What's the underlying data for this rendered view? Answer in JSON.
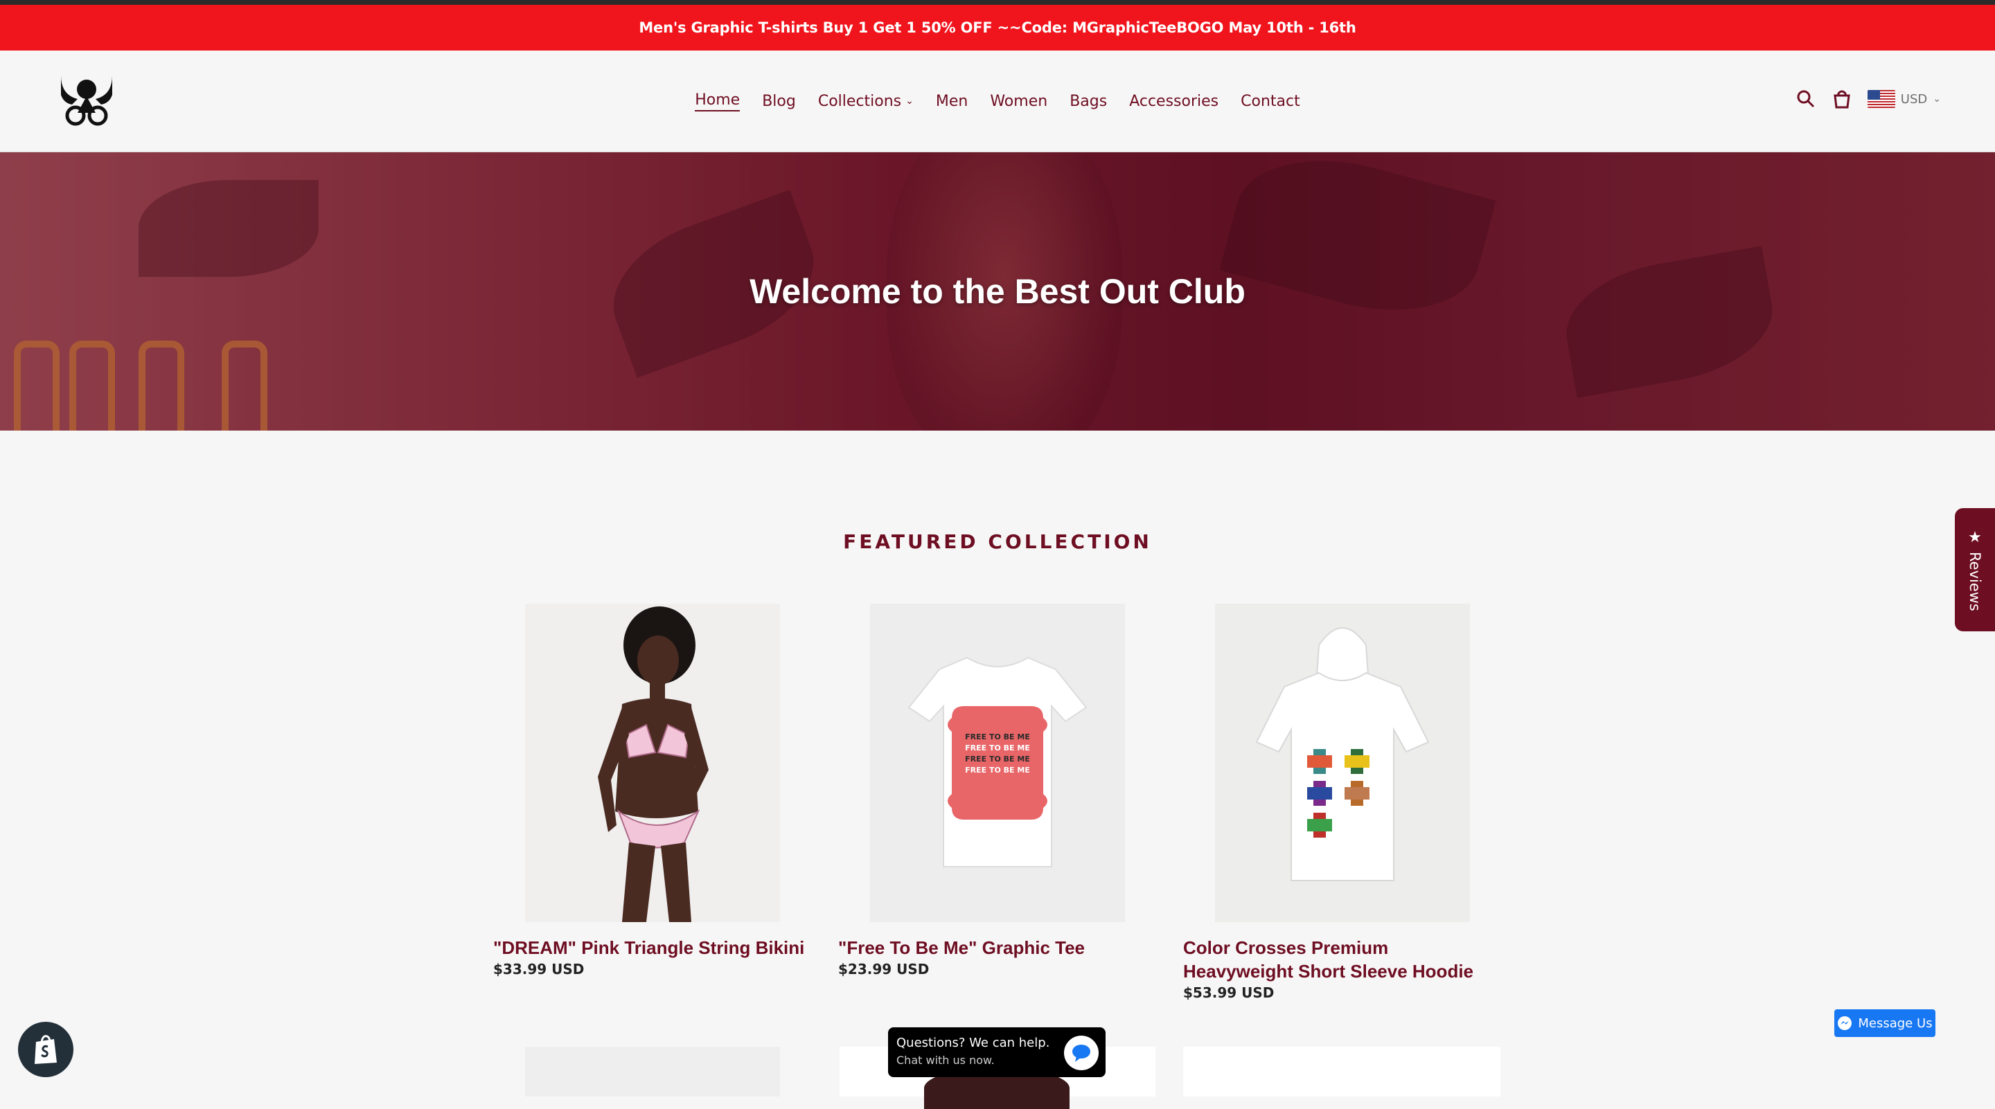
{
  "announcement": "Men's Graphic T-shirts Buy 1 Get 1 50% OFF ~~Code: MGraphicTeeBOGO May 10th - 16th",
  "nav": {
    "items": [
      {
        "label": "Home",
        "active": true
      },
      {
        "label": "Blog"
      },
      {
        "label": "Collections",
        "dropdown": true
      },
      {
        "label": "Men"
      },
      {
        "label": "Women"
      },
      {
        "label": "Bags"
      },
      {
        "label": "Accessories"
      },
      {
        "label": "Contact"
      }
    ]
  },
  "header": {
    "currency": "USD",
    "icons": [
      "search-icon",
      "cart-icon",
      "us-flag-icon",
      "chevron-down-icon"
    ]
  },
  "hero": {
    "title": "Welcome to the Best Out Club"
  },
  "featured": {
    "title": "FEATURED COLLECTION",
    "products": [
      {
        "name": "\"DREAM\" Pink Triangle String Bikini",
        "price": "$33.99 USD"
      },
      {
        "name": "\"Free To Be Me\" Graphic Tee",
        "price": "$23.99 USD",
        "print": "FREE TO BE ME"
      },
      {
        "name": "Color Crosses Premium Heavyweight Short Sleeve Hoodie",
        "price": "$53.99 USD"
      }
    ]
  },
  "reviews_tab": "Reviews",
  "messenger": "Message Us",
  "chat": {
    "line1": "Questions? We can help.",
    "line2": "Chat with us now."
  },
  "colors": {
    "brand": "#6e0e22",
    "announcement_bg": "#f0141d",
    "messenger_blue": "#1877f2"
  }
}
